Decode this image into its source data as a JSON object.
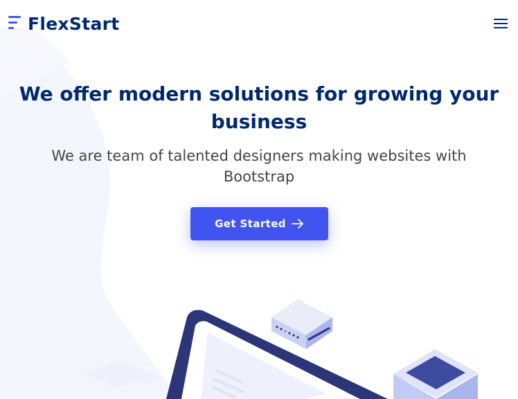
{
  "header": {
    "brand": "FlexStart",
    "logo_icon": "flexstart-logo-icon",
    "menu_icon": "hamburger-menu-icon"
  },
  "hero": {
    "title": "We offer modern solutions for growing your business",
    "subtitle": "We are team of talented designers making websites with Bootstrap",
    "cta_label": "Get Started",
    "cta_icon": "arrow-right-icon",
    "illustration_icon": "isometric-server-illustration"
  },
  "colors": {
    "brand": "#012970",
    "accent": "#4154f1",
    "text": "#444444",
    "background_tint": "#f3f5fc"
  }
}
